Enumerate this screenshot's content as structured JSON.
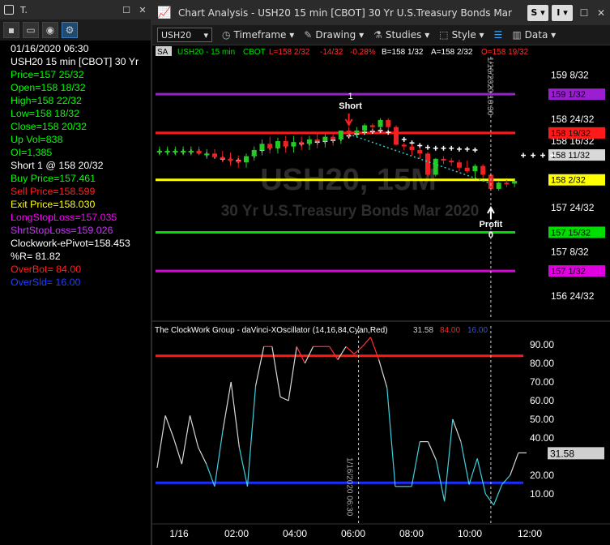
{
  "info_window": {
    "title": "T.",
    "lines": [
      {
        "text": "01/16/2020 06:30",
        "color": "#ffffff"
      },
      {
        "text": "USH20 15 min [CBOT] 30 Yr",
        "color": "#ffffff"
      },
      {
        "text": "Price=157 25/32",
        "color": "#00ff00"
      },
      {
        "text": "Open=158 18/32",
        "color": "#00ff00"
      },
      {
        "text": "High=158 22/32",
        "color": "#00ff00"
      },
      {
        "text": "Low=158 18/32",
        "color": "#00ff00"
      },
      {
        "text": "Close=158 20/32",
        "color": "#00ff00"
      },
      {
        "text": "Up Vol=838",
        "color": "#00ff00"
      },
      {
        "text": "OI=1,385",
        "color": "#00ff00"
      },
      {
        "text": "Short 1 @ 158 20/32",
        "color": "#ffffff"
      },
      {
        "text": "Buy Price=157.461",
        "color": "#00ff00"
      },
      {
        "text": "Sell Price=158.599",
        "color": "#ff2020"
      },
      {
        "text": "Exit Price=158.030",
        "color": "#ffff00"
      },
      {
        "text": "LongStopLoss=157.035",
        "color": "#ff00ff"
      },
      {
        "text": "ShrtStopLoss=159.026",
        "color": "#cc33ff"
      },
      {
        "text": "Clockwork-ePivot=158.453",
        "color": "#ffffff"
      },
      {
        "text": "%R= 81.82",
        "color": "#ffffff"
      },
      {
        "text": "OverBot= 84.00",
        "color": "#ff2020"
      },
      {
        "text": "OverSld= 16.00",
        "color": "#2040ff"
      }
    ]
  },
  "window": {
    "app": "Chart Analysis",
    "title": "Chart Analysis - USH20 15 min [CBOT] 30 Yr U.S.Treasury Bonds Mar",
    "btn_s": "S",
    "btn_i": "I"
  },
  "toolbar": {
    "symbol": "USH20",
    "timeframe": "Timeframe",
    "drawing": "Drawing",
    "studies": "Studies",
    "style": "Style",
    "data": "Data"
  },
  "price_header": {
    "sa": "SA",
    "symbol": "USH20 - 15 min",
    "exchange": "CBOT",
    "last": "L=158 2/32",
    "change": "-14/32",
    "pct": "-0.28%",
    "bid": "B=158 1/32",
    "ask": "A=158 2/32",
    "open": "O=158 19/32"
  },
  "watermark": {
    "symbol": "USH20, 15M",
    "name": "30 Yr U.S.Treasury Bonds Mar 2020"
  },
  "price_axis": [
    "159 8/32",
    "158 24/32",
    "158 16/32",
    "157 24/32",
    "157 8/32",
    "156 24/32"
  ],
  "levels": [
    {
      "label": "159 1/32",
      "value": 159.03125,
      "color": "#9b1fd1"
    },
    {
      "label": "158 19/32",
      "value": 158.59375,
      "color": "#ff1a1a"
    },
    {
      "label": "158 11/32",
      "value": 158.34375,
      "color": "#d8d8d8"
    },
    {
      "label": "158 2/32",
      "value": 158.0625,
      "color": "#ffff00"
    },
    {
      "label": "157 15/32",
      "value": 157.46875,
      "color": "#00dd00"
    },
    {
      "label": "157 1/32",
      "value": 157.03125,
      "color": "#e000e0"
    }
  ],
  "markers": {
    "short_count": "1",
    "short_label": "Short",
    "profit_label": "Profit",
    "profit_count": "0",
    "time_tag": "1/16/2020 10:30"
  },
  "oscillator": {
    "header": "The ClockWork Group - daVinci-XOscillator (14,16,84,Cyan,Red)",
    "value": "31.58",
    "overbought": "84.00",
    "oversold": "16.00",
    "last_label": "31.58",
    "axis": [
      "90.00",
      "80.00",
      "70.00",
      "60.00",
      "50.00",
      "40.00",
      "20.00",
      "10.00"
    ],
    "time_tag": "1/16/2020 06:30"
  },
  "time_axis": [
    "1/16",
    "02:00",
    "04:00",
    "06:00",
    "08:00",
    "10:00",
    "12:00"
  ],
  "chart_data": {
    "type": "line",
    "oscillator_values": [
      24,
      52,
      40,
      26,
      52,
      35,
      26,
      14,
      44,
      70,
      35,
      14,
      68,
      89,
      89,
      62,
      60,
      89,
      80,
      89,
      89,
      89,
      82,
      89,
      85,
      89,
      94,
      82,
      67,
      14,
      14,
      14,
      38,
      38,
      28,
      6,
      50,
      38,
      15,
      29,
      10,
      4,
      15,
      20,
      32,
      32
    ],
    "ylim": [
      0,
      100
    ],
    "price_candles": [
      [
        158.39,
        158.44,
        158.34,
        158.39
      ],
      [
        158.39,
        158.44,
        158.34,
        158.39
      ],
      [
        158.39,
        158.44,
        158.34,
        158.39
      ],
      [
        158.39,
        158.44,
        158.34,
        158.39
      ],
      [
        158.39,
        158.44,
        158.34,
        158.39
      ],
      [
        158.39,
        158.44,
        158.34,
        158.36
      ],
      [
        158.36,
        158.41,
        158.3,
        158.36
      ],
      [
        158.36,
        158.41,
        158.3,
        158.32
      ],
      [
        158.32,
        158.39,
        158.26,
        158.3
      ],
      [
        158.3,
        158.37,
        158.22,
        158.28
      ],
      [
        158.28,
        158.34,
        158.2,
        158.26
      ],
      [
        158.26,
        158.36,
        158.2,
        158.33
      ],
      [
        158.33,
        158.44,
        158.28,
        158.4
      ],
      [
        158.4,
        158.52,
        158.34,
        158.47
      ],
      [
        158.47,
        158.55,
        158.36,
        158.42
      ],
      [
        158.42,
        158.54,
        158.36,
        158.5
      ],
      [
        158.5,
        158.56,
        158.37,
        158.44
      ],
      [
        158.44,
        158.56,
        158.37,
        158.49
      ],
      [
        158.49,
        158.55,
        158.4,
        158.47
      ],
      [
        158.47,
        158.56,
        158.4,
        158.52
      ],
      [
        158.52,
        158.58,
        158.42,
        158.5
      ],
      [
        158.5,
        158.58,
        158.43,
        158.55
      ],
      [
        158.55,
        158.59,
        158.45,
        158.52
      ],
      [
        158.52,
        158.62,
        158.47,
        158.62
      ],
      [
        158.62,
        158.66,
        158.55,
        158.6
      ],
      [
        158.6,
        158.66,
        158.55,
        158.62
      ],
      [
        158.62,
        158.7,
        158.58,
        158.68
      ],
      [
        158.68,
        158.7,
        158.6,
        158.66
      ],
      [
        158.66,
        158.76,
        158.62,
        158.74
      ],
      [
        158.74,
        158.76,
        158.62,
        158.66
      ],
      [
        158.66,
        158.68,
        158.45,
        158.46
      ],
      [
        158.46,
        158.48,
        158.4,
        158.44
      ],
      [
        158.44,
        158.47,
        158.34,
        158.4
      ],
      [
        158.4,
        158.43,
        158.3,
        158.36
      ],
      [
        158.36,
        158.38,
        158.1,
        158.12
      ],
      [
        158.12,
        158.31,
        158.1,
        158.3
      ],
      [
        158.3,
        158.33,
        158.24,
        158.28
      ],
      [
        158.28,
        158.31,
        158.22,
        158.26
      ],
      [
        158.26,
        158.29,
        158.16,
        158.2
      ],
      [
        158.2,
        158.28,
        158.14,
        158.16
      ],
      [
        158.16,
        158.24,
        158.08,
        158.22
      ],
      [
        158.22,
        158.24,
        158.08,
        158.12
      ],
      [
        158.12,
        158.14,
        157.94,
        157.96
      ],
      [
        157.96,
        158.04,
        157.94,
        158.03
      ],
      [
        158.03,
        158.06,
        157.98,
        158.02
      ],
      [
        158.02,
        158.07,
        157.98,
        158.05
      ]
    ],
    "price_ylim": [
      156.5,
      159.4
    ]
  }
}
